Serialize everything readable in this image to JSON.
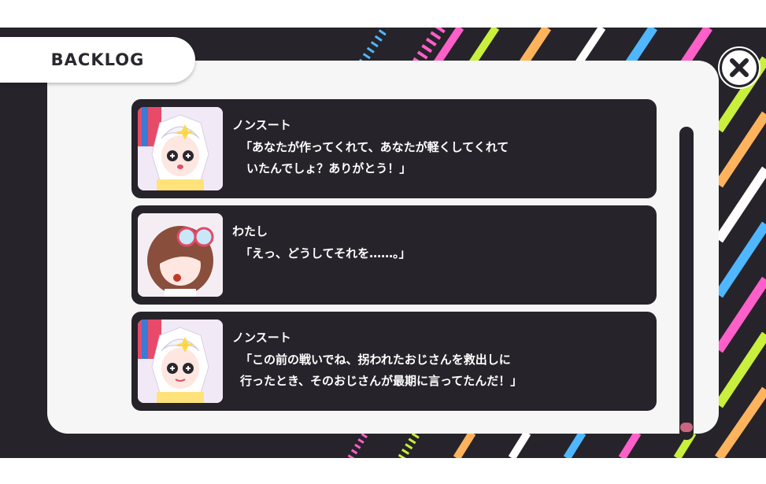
{
  "header": {
    "title": "BACKLOG"
  },
  "close_button": {
    "icon": "close-icon"
  },
  "entries": [
    {
      "speaker": "ノンスート",
      "avatar": "nonsuto-portrait",
      "lines": [
        "「あなたが作ってくれて、あなたが軽くしてくれて",
        "いたんでしょ？ありがとう！」"
      ]
    },
    {
      "speaker": "わたし",
      "avatar": "watashi-portrait",
      "lines": [
        "「えっ、どうしてそれを……。」"
      ]
    },
    {
      "speaker": "ノンスート",
      "avatar": "nonsuto-portrait",
      "lines": [
        "「この前の戦いでね、拐われたおじさんを救出しに",
        "行ったとき、そのおじさんが最期に言ってたんだ！」"
      ]
    }
  ],
  "scrollbar": {
    "position": 1.0,
    "thumb_color": "#c9657f"
  },
  "colors": {
    "background": "#26232a",
    "panel": "#f6f6f6",
    "entry": "#26232a",
    "stripes": [
      "#ff5fc8",
      "#c8f03c",
      "#ffb35c",
      "#ffffff",
      "#4fb7ff"
    ]
  }
}
